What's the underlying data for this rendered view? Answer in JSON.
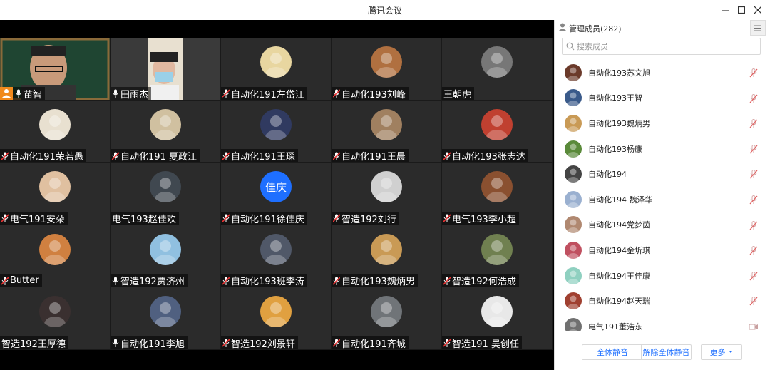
{
  "window": {
    "title": "腾讯会议"
  },
  "panel": {
    "title": "管理成员(282)",
    "search_placeholder": "搜索成员",
    "members": [
      {
        "name": "自动化193苏文旭",
        "avatar_color": "#6b3a2a"
      },
      {
        "name": "自动化193王智",
        "avatar_color": "#3a5a8a"
      },
      {
        "name": "自动化193魏炳男",
        "avatar_color": "#c99a55"
      },
      {
        "name": "自动化193杨康",
        "avatar_color": "#5a8a3a"
      },
      {
        "name": "自动化194",
        "avatar_color": "#444444"
      },
      {
        "name": "自动化194  魏泽华",
        "avatar_color": "#9ab0d0"
      },
      {
        "name": "自动化194党梦茵",
        "avatar_color": "#b08870"
      },
      {
        "name": "自动化194金圻琪",
        "avatar_color": "#c05060"
      },
      {
        "name": "自动化194王佳康",
        "avatar_color": "#8fd0c0"
      },
      {
        "name": "自动化194赵天瑞",
        "avatar_color": "#a04030"
      },
      {
        "name": "电气191董浩东",
        "avatar_color": "#707070"
      }
    ],
    "buttons": {
      "mute_all": "全体静音",
      "unmute_all": "解除全体静音",
      "more": "更多"
    }
  },
  "tiles": [
    {
      "name": "苗智",
      "type": "camera1",
      "host": true,
      "mic": "on"
    },
    {
      "name": "田雨杰",
      "type": "camera2",
      "mic": "on"
    },
    {
      "name": "自动化191左岱江",
      "color": "#e8d6a0",
      "mic": "muted"
    },
    {
      "name": "自动化193刘峰",
      "color": "#b07040",
      "mic": "muted"
    },
    {
      "name": "王朝虎",
      "color": "#777777",
      "mic": "none"
    },
    {
      "name": "自动化191荣若愚",
      "color": "#e8e0d0",
      "mic": "muted"
    },
    {
      "name": "自动化191 夏政江",
      "color": "#d0c0a0",
      "mic": "muted"
    },
    {
      "name": "自动化191王琛",
      "color": "#303a60",
      "mic": "muted"
    },
    {
      "name": "自动化191王晨",
      "color": "#a08060",
      "mic": "muted"
    },
    {
      "name": "自动化193张志达",
      "color": "#c04030",
      "mic": "muted"
    },
    {
      "name": "电气191安朵",
      "color": "#e0c0a0",
      "mic": "muted"
    },
    {
      "name": "电气193赵佳欢",
      "color": "#404850",
      "mic": "none"
    },
    {
      "name": "自动化191徐佳庆",
      "text": "佳庆",
      "mic": "muted"
    },
    {
      "name": "智造192刘行",
      "color": "#d0d0d0",
      "mic": "muted"
    },
    {
      "name": "电气193李小超",
      "color": "#8a5030",
      "mic": "muted"
    },
    {
      "name": "Butter",
      "color": "#d08040",
      "mic": "muted"
    },
    {
      "name": "智造192贾济州",
      "color": "#90c0e0",
      "mic": "on"
    },
    {
      "name": "自动化193班李涛",
      "color": "#505868",
      "mic": "muted"
    },
    {
      "name": "自动化193魏炳男",
      "color": "#c99a55",
      "mic": "muted"
    },
    {
      "name": "智造192何浩成",
      "color": "#708050",
      "mic": "muted"
    },
    {
      "name": "智造192王厚德",
      "color": "#3a3030",
      "mic": "none"
    },
    {
      "name": "自动化191李旭",
      "color": "#506080",
      "mic": "on"
    },
    {
      "name": "智造192刘景轩",
      "color": "#e0a040",
      "mic": "muted"
    },
    {
      "name": "自动化191齐城",
      "color": "#707478",
      "mic": "muted"
    },
    {
      "name": "智造191 吴创任",
      "color": "#e8e8e8",
      "mic": "muted"
    }
  ]
}
